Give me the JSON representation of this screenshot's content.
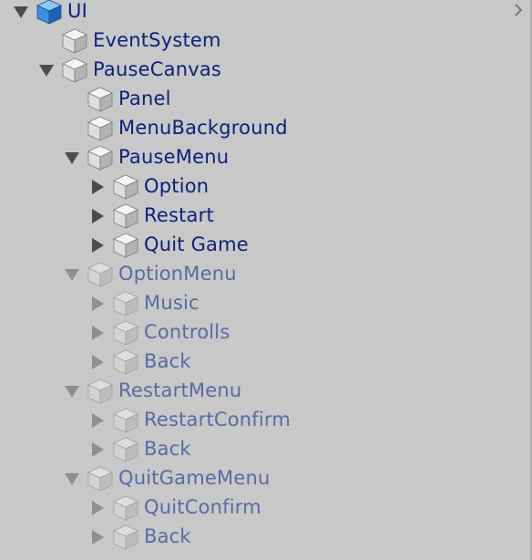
{
  "panel": "hierarchy",
  "colors": {
    "background": "#c8c8c8",
    "active_label": "#0c1f7a",
    "inactive_label": "#596aa3",
    "arrow_active": "#4b4b4b",
    "arrow_inactive": "#8f8f8f",
    "root_cube": "#2f83d6"
  },
  "items": [
    {
      "label": "UI",
      "depth": 0,
      "arrow": "expanded",
      "icon": "blue-cube-icon",
      "active": true,
      "slug": "ui"
    },
    {
      "label": "EventSystem",
      "depth": 1,
      "arrow": "none",
      "icon": "cube-icon",
      "active": true,
      "slug": "eventsystem"
    },
    {
      "label": "PauseCanvas",
      "depth": 1,
      "arrow": "expanded",
      "icon": "cube-icon",
      "active": true,
      "slug": "pausecanvas"
    },
    {
      "label": "Panel",
      "depth": 2,
      "arrow": "none",
      "icon": "cube-icon",
      "active": true,
      "slug": "panel"
    },
    {
      "label": "MenuBackground",
      "depth": 2,
      "arrow": "none",
      "icon": "cube-icon",
      "active": true,
      "slug": "menubackground"
    },
    {
      "label": "PauseMenu",
      "depth": 2,
      "arrow": "expanded",
      "icon": "cube-icon",
      "active": true,
      "slug": "pausemenu"
    },
    {
      "label": "Option",
      "depth": 3,
      "arrow": "collapsed",
      "icon": "cube-icon",
      "active": true,
      "slug": "option"
    },
    {
      "label": "Restart",
      "depth": 3,
      "arrow": "collapsed",
      "icon": "cube-icon",
      "active": true,
      "slug": "restart"
    },
    {
      "label": "Quit Game",
      "depth": 3,
      "arrow": "collapsed",
      "icon": "cube-icon",
      "active": true,
      "slug": "quit-game"
    },
    {
      "label": "OptionMenu",
      "depth": 2,
      "arrow": "expanded",
      "icon": "cube-icon",
      "active": false,
      "slug": "optionmenu"
    },
    {
      "label": "Music",
      "depth": 3,
      "arrow": "collapsed",
      "icon": "cube-icon",
      "active": false,
      "slug": "music"
    },
    {
      "label": "Controlls",
      "depth": 3,
      "arrow": "collapsed",
      "icon": "cube-icon",
      "active": false,
      "slug": "controlls"
    },
    {
      "label": "Back",
      "depth": 3,
      "arrow": "collapsed",
      "icon": "cube-icon",
      "active": false,
      "slug": "back-option"
    },
    {
      "label": "RestartMenu",
      "depth": 2,
      "arrow": "expanded",
      "icon": "cube-icon",
      "active": false,
      "slug": "restartmenu"
    },
    {
      "label": "RestartConfirm",
      "depth": 3,
      "arrow": "collapsed",
      "icon": "cube-icon",
      "active": false,
      "slug": "restartconfirm"
    },
    {
      "label": "Back",
      "depth": 3,
      "arrow": "collapsed",
      "icon": "cube-icon",
      "active": false,
      "slug": "back-restart"
    },
    {
      "label": "QuitGameMenu",
      "depth": 2,
      "arrow": "expanded",
      "icon": "cube-icon",
      "active": false,
      "slug": "quitgamemenu"
    },
    {
      "label": "QuitConfirm",
      "depth": 3,
      "arrow": "collapsed",
      "icon": "cube-icon",
      "active": false,
      "slug": "quitconfirm"
    },
    {
      "label": "Back",
      "depth": 3,
      "arrow": "collapsed",
      "icon": "cube-icon",
      "active": false,
      "slug": "back-quit"
    }
  ]
}
